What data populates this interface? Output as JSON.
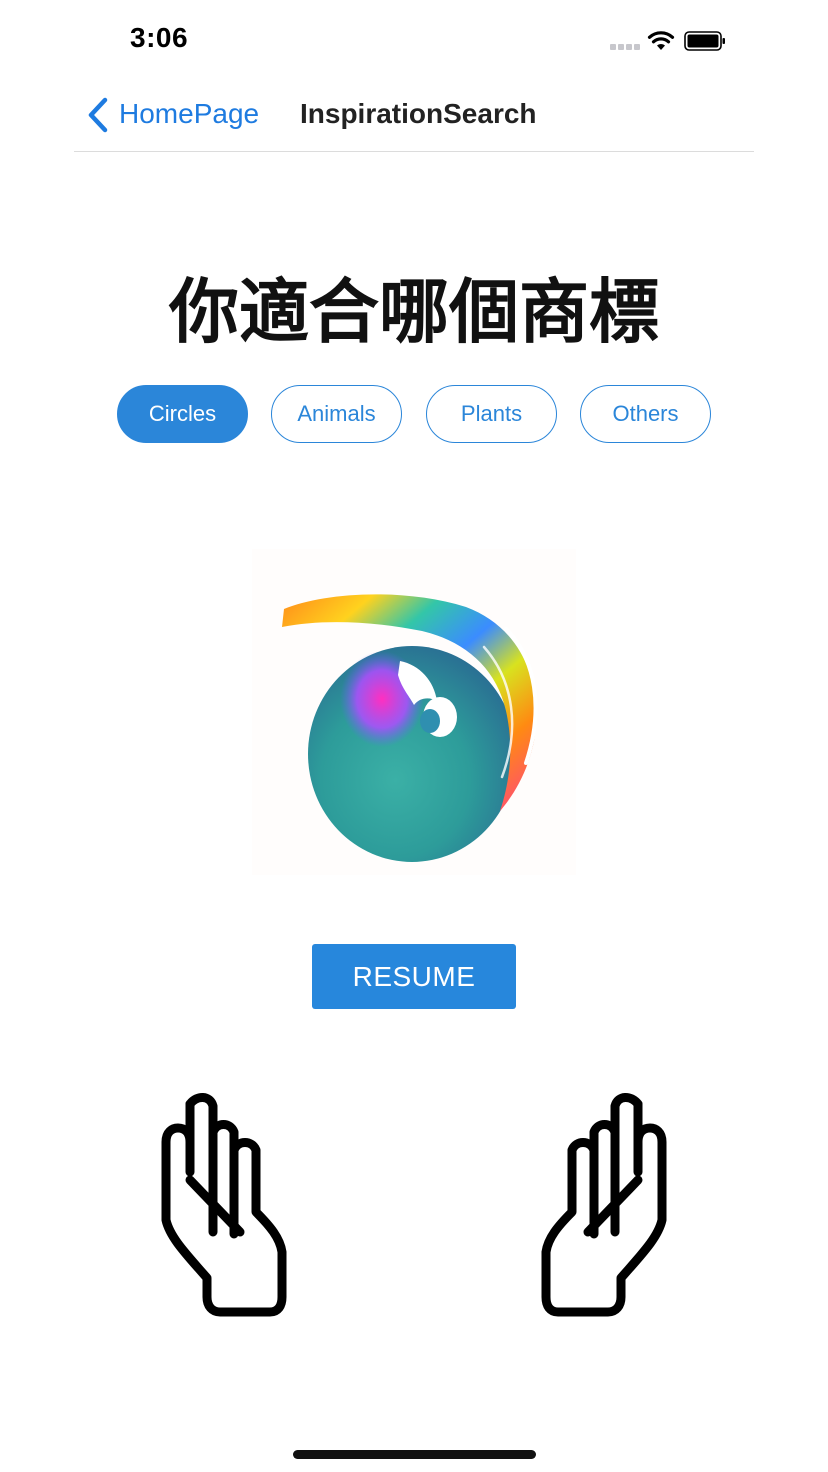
{
  "status_bar": {
    "time": "3:06"
  },
  "nav": {
    "back_label": "HomePage",
    "title": "InspirationSearch"
  },
  "heading": "你適合哪個商標",
  "categories": [
    {
      "label": "Circles",
      "selected": true
    },
    {
      "label": "Animals",
      "selected": false
    },
    {
      "label": "Plants",
      "selected": false
    },
    {
      "label": "Others",
      "selected": false
    }
  ],
  "logo": {
    "icon": "rainbow-swirl-logo-image"
  },
  "resume_label": "RESUME",
  "gestures": {
    "left_icon": "raised-hand-left-icon",
    "right_icon": "raised-hand-right-icon"
  },
  "colors": {
    "accent": "#2b86d9",
    "text": "#111111",
    "back_link": "#1e7be0"
  }
}
